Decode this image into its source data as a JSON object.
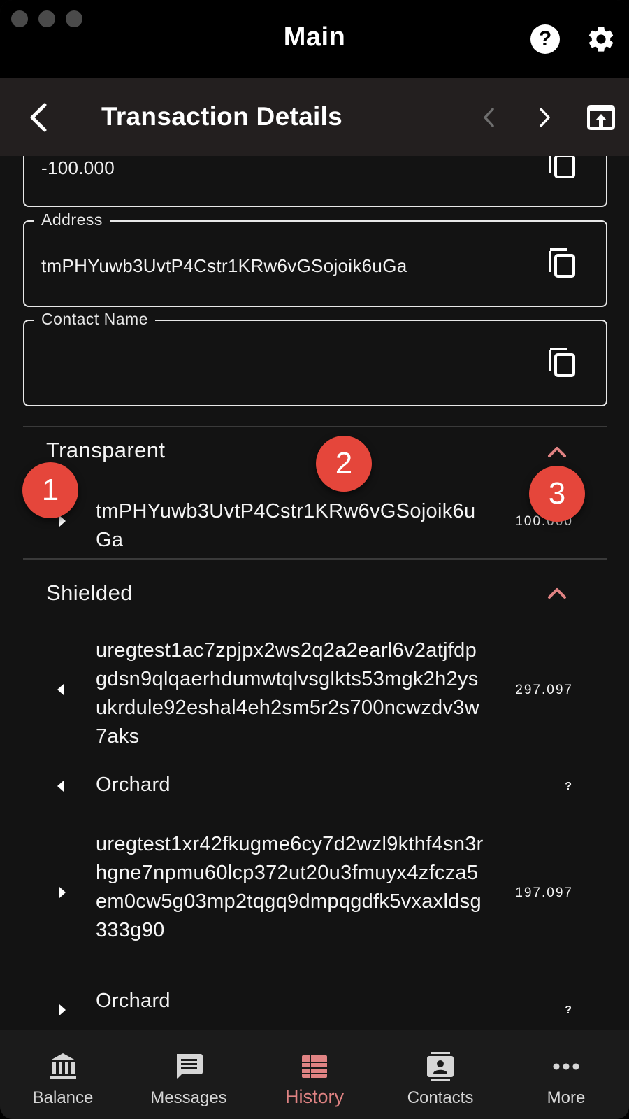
{
  "window": {
    "title": "Main"
  },
  "header": {
    "title": "Transaction Details"
  },
  "fields": {
    "amount_value": "-100.000",
    "address_label": "Address",
    "address_value": "tmPHYuwb3UvtP4Cstr1KRw6vGSojoik6uGa",
    "contact_label": "Contact Name",
    "contact_value": ""
  },
  "transparent": {
    "title": "Transparent",
    "rows": [
      {
        "address": "tmPHYuwb3UvtP4Cstr1KRw6vGSojoik6uGa",
        "amount": "100.000"
      }
    ]
  },
  "shielded": {
    "title": "Shielded",
    "rows": [
      {
        "address": "uregtest1ac7zpjpx2ws2q2a2earl6v2atjfdpgdsn9qlqaerhdumwtqlvsglkts53mgk2h2ysukrdule92eshal4eh2sm5r2s700ncwzdv3w7aks",
        "amount": "297.097"
      },
      {
        "address": "Orchard",
        "amount": "?"
      },
      {
        "address": "uregtest1xr42fkugme6cy7d2wzl9kthf4sn3rhgne7npmu60lcp372ut20u3fmuyx4zfcza5em0cw5g03mp2tqgq9dmpqgdfk5vxaxldsg333g90",
        "amount": "197.097"
      },
      {
        "address": "Orchard",
        "amount": "?"
      }
    ]
  },
  "badges": [
    "1",
    "2",
    "3"
  ],
  "nav": {
    "items": [
      {
        "label": "Balance",
        "icon": "bank-icon"
      },
      {
        "label": "Messages",
        "icon": "message-icon"
      },
      {
        "label": "History",
        "icon": "history-icon",
        "active": true
      },
      {
        "label": "Contacts",
        "icon": "contacts-icon"
      },
      {
        "label": "More",
        "icon": "more-icon"
      }
    ]
  },
  "colors": {
    "accent": "#e08383",
    "badge": "#e5463b",
    "background": "#131313"
  }
}
